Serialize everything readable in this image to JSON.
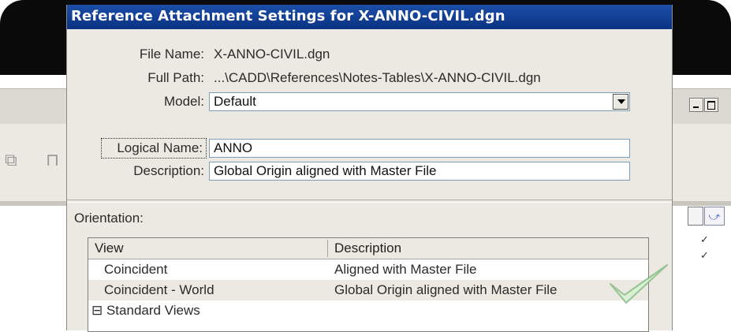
{
  "dialog": {
    "title": "Reference Attachment Settings for X-ANNO-CIVIL.dgn",
    "file_name_label": "File Name:",
    "file_name_value": "X-ANNO-CIVIL.dgn",
    "full_path_label": "Full Path:",
    "full_path_value": "...\\CADD\\References\\Notes-Tables\\X-ANNO-CIVIL.dgn",
    "model_label": "Model:",
    "model_value": "Default",
    "logical_name_label": "Logical Name:",
    "logical_name_value": "ANNO",
    "description_label": "Description:",
    "description_value": "Global Origin aligned with Master File",
    "orientation_label": "Orientation:",
    "table": {
      "headers": [
        "View",
        "Description"
      ],
      "rows": [
        {
          "view": "Coincident",
          "description": "Aligned with Master File"
        },
        {
          "view": "Coincident - World",
          "description": "Global Origin aligned with Master File"
        },
        {
          "view": "⊟ Standard Views",
          "description": ""
        }
      ]
    }
  },
  "colors": {
    "title_bar": "#0b3a8a",
    "dialog_bg": "#ece9e2",
    "checkmark": "#8fd18a"
  },
  "icons": {
    "dropdown": "chevron-down-icon",
    "check": "checkmark-icon"
  }
}
